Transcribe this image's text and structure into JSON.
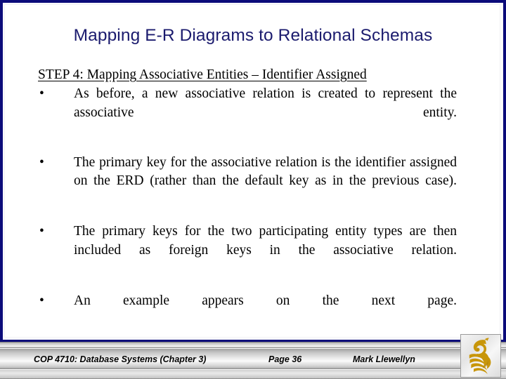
{
  "slide": {
    "title": "Mapping E-R Diagrams to Relational Schemas",
    "heading": "STEP 4:  Mapping Associative Entities – Identifier Assigned",
    "bullets": [
      {
        "marker": "•",
        "text": "As before, a new associative relation is created to represent the associative entity."
      },
      {
        "marker": "•",
        "text": "The primary key for the associative relation is the identifier assigned on the ERD (rather than the default key as in the previous case)."
      },
      {
        "marker": "•",
        "text": "The primary keys for the two participating entity types are then included as foreign keys in the associative relation."
      },
      {
        "marker": "•",
        "text": "An example appears on the next page."
      }
    ]
  },
  "footer": {
    "course": "COP 4710: Database Systems  (Chapter 3)",
    "page": "Page 36",
    "author": "Mark Llewellyn",
    "logo_name": "ucf-pegasus-logo"
  },
  "colors": {
    "title": "#1b1b6e",
    "border": "#0b0b7a",
    "body_text": "#000000",
    "logo_gold": "#c8960a",
    "logo_gold_dark": "#a87a05",
    "footer_band": "#ececec"
  }
}
